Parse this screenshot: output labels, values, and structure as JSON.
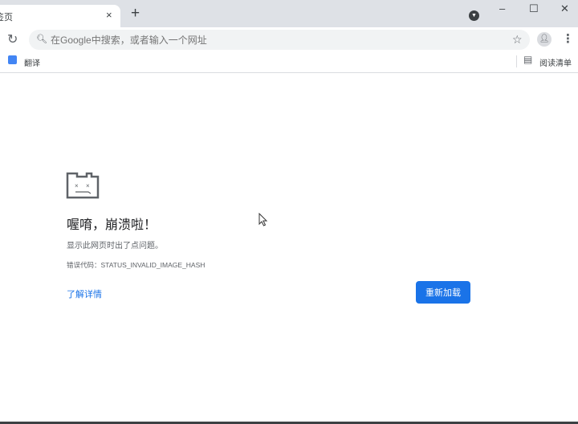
{
  "tab": {
    "title": "新标签页",
    "close": "×",
    "new_tab": "+"
  },
  "window": {
    "minimize": "–",
    "maximize": "☐",
    "close": "✕"
  },
  "toolbar": {
    "omnibox_placeholder": "在Google中搜索，或者输入一个网址"
  },
  "bookmarks": {
    "items": [
      {
        "label": "翻译"
      }
    ],
    "reading_list": "阅读清单"
  },
  "error": {
    "title": "喔唷，崩溃啦！",
    "message": "显示此网页时出了点问题。",
    "code": "错误代码：STATUS_INVALID_IMAGE_HASH",
    "learn_more": "了解详情",
    "reload": "重新加载"
  },
  "colors": {
    "accent": "#1a73e8",
    "tabstrip": "#dee1e6"
  }
}
